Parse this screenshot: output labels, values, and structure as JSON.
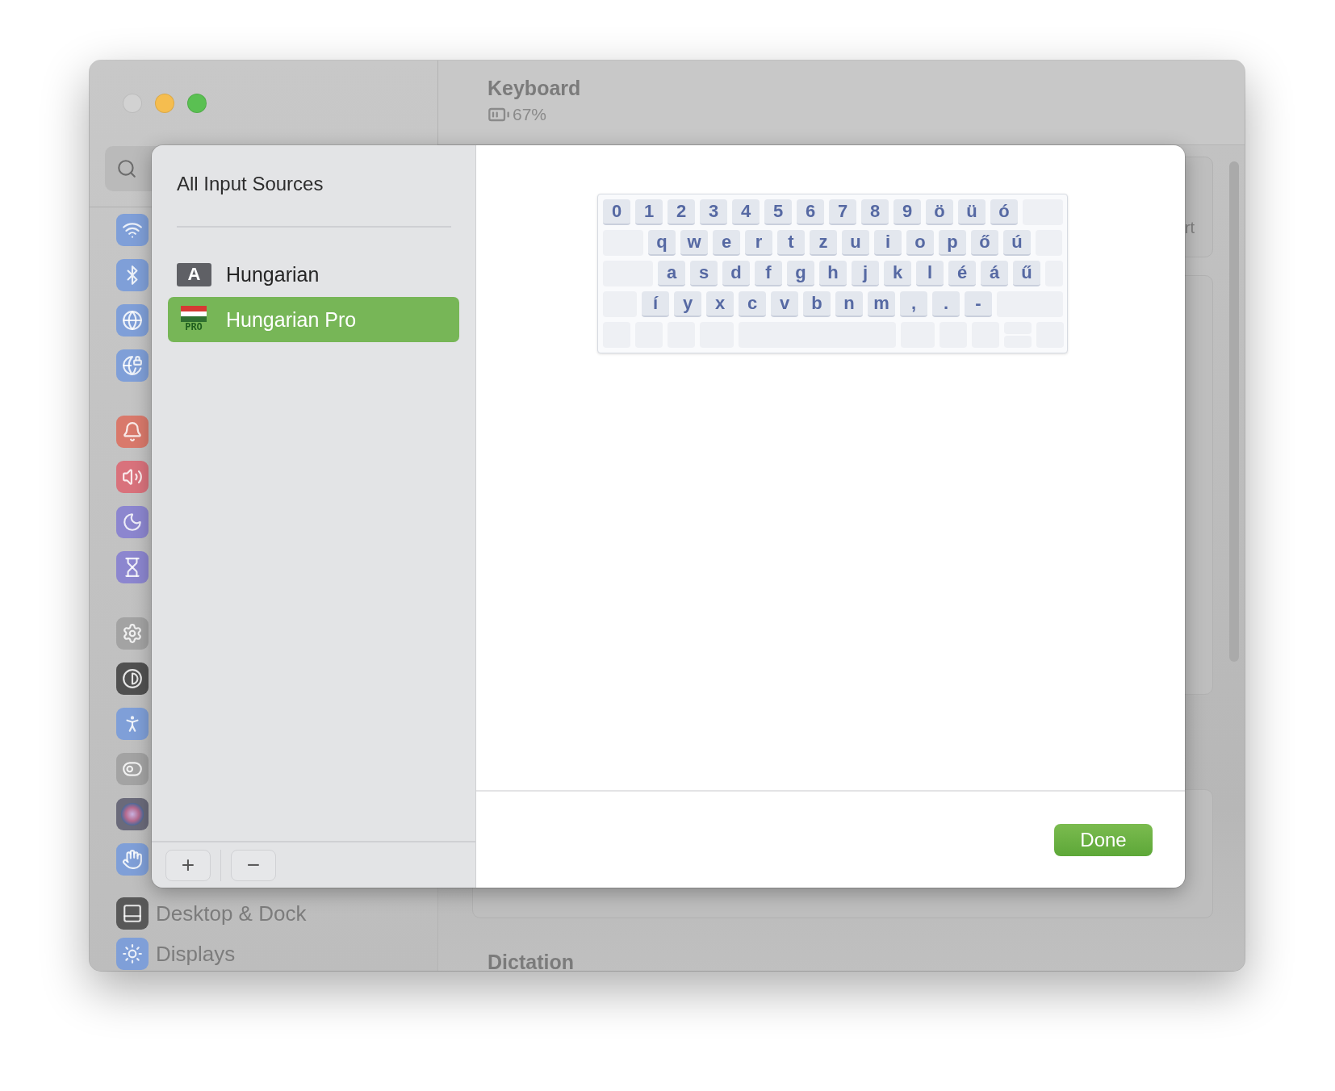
{
  "window": {
    "title": "Keyboard",
    "battery": "67%"
  },
  "sidebar": {
    "groups": [
      [
        {
          "kind": "wifi"
        },
        {
          "kind": "bluetooth"
        },
        {
          "kind": "network"
        },
        {
          "kind": "vpn"
        }
      ],
      [
        {
          "kind": "notifications"
        },
        {
          "kind": "sound"
        },
        {
          "kind": "focus"
        },
        {
          "kind": "screen-time"
        }
      ],
      [
        {
          "kind": "general"
        },
        {
          "kind": "appearance"
        },
        {
          "kind": "accessibility"
        },
        {
          "kind": "control-center"
        },
        {
          "kind": "siri"
        },
        {
          "kind": "privacy"
        }
      ],
      [
        {
          "kind": "dock",
          "label": "Desktop & Dock"
        },
        {
          "kind": "displays",
          "label": "Displays"
        }
      ]
    ]
  },
  "content": {
    "peek_text": "rt",
    "section_heading": "Dictation"
  },
  "sheet": {
    "title": "All Input Sources",
    "sources": [
      {
        "kind": "letter",
        "icon_text": "A",
        "name": "Hungarian",
        "selected": false
      },
      {
        "kind": "flag",
        "icon_text": "PRO",
        "name": "Hungarian Pro",
        "selected": true
      }
    ],
    "add_button": "+",
    "remove_button": "−",
    "done_button": "Done",
    "keyboard": {
      "rows": [
        [
          {
            "kind": "char",
            "label": "0"
          },
          {
            "kind": "char",
            "label": "1"
          },
          {
            "kind": "char",
            "label": "2"
          },
          {
            "kind": "char",
            "label": "3"
          },
          {
            "kind": "char",
            "label": "4"
          },
          {
            "kind": "char",
            "label": "5"
          },
          {
            "kind": "char",
            "label": "6"
          },
          {
            "kind": "char",
            "label": "7"
          },
          {
            "kind": "char",
            "label": "8"
          },
          {
            "kind": "char",
            "label": "9"
          },
          {
            "kind": "char",
            "label": "ö"
          },
          {
            "kind": "char",
            "label": "ü"
          },
          {
            "kind": "char",
            "label": "ó"
          },
          {
            "kind": "delete"
          }
        ],
        [
          {
            "kind": "tab"
          },
          {
            "kind": "char",
            "label": "q"
          },
          {
            "kind": "char",
            "label": "w"
          },
          {
            "kind": "char",
            "label": "e"
          },
          {
            "kind": "char",
            "label": "r"
          },
          {
            "kind": "char",
            "label": "t"
          },
          {
            "kind": "char",
            "label": "z"
          },
          {
            "kind": "char",
            "label": "u"
          },
          {
            "kind": "char",
            "label": "i"
          },
          {
            "kind": "char",
            "label": "o"
          },
          {
            "kind": "char",
            "label": "p"
          },
          {
            "kind": "char",
            "label": "ő"
          },
          {
            "kind": "char",
            "label": "ú"
          },
          {
            "kind": "return-top"
          }
        ],
        [
          {
            "kind": "caps"
          },
          {
            "kind": "char",
            "label": "a"
          },
          {
            "kind": "char",
            "label": "s"
          },
          {
            "kind": "char",
            "label": "d"
          },
          {
            "kind": "char",
            "label": "f"
          },
          {
            "kind": "char",
            "label": "g"
          },
          {
            "kind": "char",
            "label": "h"
          },
          {
            "kind": "char",
            "label": "j"
          },
          {
            "kind": "char",
            "label": "k"
          },
          {
            "kind": "char",
            "label": "l"
          },
          {
            "kind": "char",
            "label": "é"
          },
          {
            "kind": "char",
            "label": "á"
          },
          {
            "kind": "char",
            "label": "ű"
          },
          {
            "kind": "return-bottom"
          }
        ],
        [
          {
            "kind": "shift"
          },
          {
            "kind": "char",
            "label": "í"
          },
          {
            "kind": "char",
            "label": "y"
          },
          {
            "kind": "char",
            "label": "x"
          },
          {
            "kind": "char",
            "label": "c"
          },
          {
            "kind": "char",
            "label": "v"
          },
          {
            "kind": "char",
            "label": "b"
          },
          {
            "kind": "char",
            "label": "n"
          },
          {
            "kind": "char",
            "label": "m"
          },
          {
            "kind": "char",
            "label": ","
          },
          {
            "kind": "char",
            "label": "."
          },
          {
            "kind": "char",
            "label": "-"
          },
          {
            "kind": "right-shift"
          }
        ],
        [
          {
            "kind": "fn"
          },
          {
            "kind": "control"
          },
          {
            "kind": "option"
          },
          {
            "kind": "command"
          },
          {
            "kind": "space"
          },
          {
            "kind": "command"
          },
          {
            "kind": "option"
          },
          {
            "kind": "arrow"
          },
          {
            "kind": "arrow-updown"
          },
          {
            "kind": "arrow"
          }
        ]
      ]
    }
  }
}
